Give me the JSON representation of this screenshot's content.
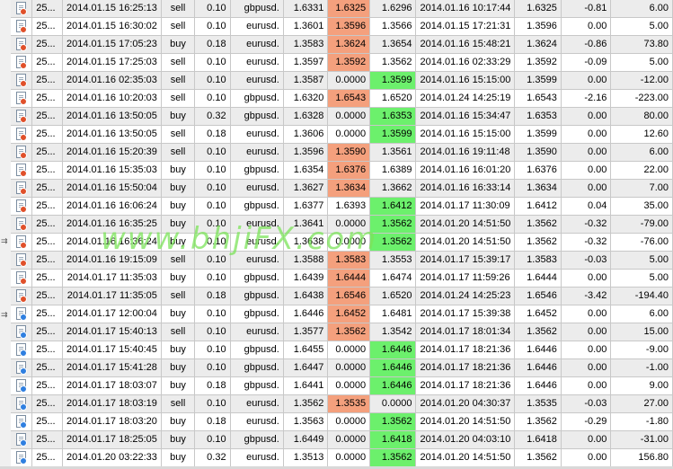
{
  "watermark": "www.bhjiFX.com",
  "colors": {
    "loss_price": "#f4a07d",
    "win_price": "#6cf06c",
    "sell_dot": "#e0502a",
    "buy_dot": "#2f7fe0"
  },
  "trades": [
    {
      "ticket": "25...",
      "open_time": "2014.01.15 16:25:13",
      "type": "sell",
      "size": "0.10",
      "symbol": "gbpusd.",
      "open_price": "1.6331",
      "sl": "1.6325",
      "tp": "1.6296",
      "close_time": "2014.01.16 10:17:44",
      "close_price": "1.6325",
      "swap": "-0.81",
      "profit": "6.00",
      "hl": "sl",
      "icon": "sell"
    },
    {
      "ticket": "25...",
      "open_time": "2014.01.15 16:30:02",
      "type": "sell",
      "size": "0.10",
      "symbol": "eurusd.",
      "open_price": "1.3601",
      "sl": "1.3596",
      "tp": "1.3566",
      "close_time": "2014.01.15 17:21:31",
      "close_price": "1.3596",
      "swap": "0.00",
      "profit": "5.00",
      "hl": "sl",
      "icon": "sell"
    },
    {
      "ticket": "25...",
      "open_time": "2014.01.15 17:05:23",
      "type": "buy",
      "size": "0.18",
      "symbol": "eurusd.",
      "open_price": "1.3583",
      "sl": "1.3624",
      "tp": "1.3654",
      "close_time": "2014.01.16 15:48:21",
      "close_price": "1.3624",
      "swap": "-0.86",
      "profit": "73.80",
      "hl": "sl",
      "icon": "sell"
    },
    {
      "ticket": "25...",
      "open_time": "2014.01.15 17:25:03",
      "type": "sell",
      "size": "0.10",
      "symbol": "eurusd.",
      "open_price": "1.3597",
      "sl": "1.3592",
      "tp": "1.3562",
      "close_time": "2014.01.16 02:33:29",
      "close_price": "1.3592",
      "swap": "-0.09",
      "profit": "5.00",
      "hl": "sl",
      "icon": "sell"
    },
    {
      "ticket": "25...",
      "open_time": "2014.01.16 02:35:03",
      "type": "sell",
      "size": "0.10",
      "symbol": "eurusd.",
      "open_price": "1.3587",
      "sl": "0.0000",
      "tp": "1.3599",
      "close_time": "2014.01.16 15:15:00",
      "close_price": "1.3599",
      "swap": "0.00",
      "profit": "-12.00",
      "hl": "tp",
      "icon": "sell"
    },
    {
      "ticket": "25...",
      "open_time": "2014.01.16 10:20:03",
      "type": "sell",
      "size": "0.10",
      "symbol": "gbpusd.",
      "open_price": "1.6320",
      "sl": "1.6543",
      "tp": "1.6520",
      "close_time": "2014.01.24 14:25:19",
      "close_price": "1.6543",
      "swap": "-2.16",
      "profit": "-223.00",
      "hl": "sl",
      "icon": "sell"
    },
    {
      "ticket": "25...",
      "open_time": "2014.01.16 13:50:05",
      "type": "buy",
      "size": "0.32",
      "symbol": "gbpusd.",
      "open_price": "1.6328",
      "sl": "0.0000",
      "tp": "1.6353",
      "close_time": "2014.01.16 15:34:47",
      "close_price": "1.6353",
      "swap": "0.00",
      "profit": "80.00",
      "hl": "tp",
      "icon": "sell"
    },
    {
      "ticket": "25...",
      "open_time": "2014.01.16 13:50:05",
      "type": "sell",
      "size": "0.18",
      "symbol": "eurusd.",
      "open_price": "1.3606",
      "sl": "0.0000",
      "tp": "1.3599",
      "close_time": "2014.01.16 15:15:00",
      "close_price": "1.3599",
      "swap": "0.00",
      "profit": "12.60",
      "hl": "tp",
      "icon": "sell"
    },
    {
      "ticket": "25...",
      "open_time": "2014.01.16 15:20:39",
      "type": "sell",
      "size": "0.10",
      "symbol": "eurusd.",
      "open_price": "1.3596",
      "sl": "1.3590",
      "tp": "1.3561",
      "close_time": "2014.01.16 19:11:48",
      "close_price": "1.3590",
      "swap": "0.00",
      "profit": "6.00",
      "hl": "sl",
      "icon": "sell"
    },
    {
      "ticket": "25...",
      "open_time": "2014.01.16 15:35:03",
      "type": "buy",
      "size": "0.10",
      "symbol": "gbpusd.",
      "open_price": "1.6354",
      "sl": "1.6376",
      "tp": "1.6389",
      "close_time": "2014.01.16 16:01:20",
      "close_price": "1.6376",
      "swap": "0.00",
      "profit": "22.00",
      "hl": "sl",
      "icon": "sell"
    },
    {
      "ticket": "25...",
      "open_time": "2014.01.16 15:50:04",
      "type": "buy",
      "size": "0.10",
      "symbol": "eurusd.",
      "open_price": "1.3627",
      "sl": "1.3634",
      "tp": "1.3662",
      "close_time": "2014.01.16 16:33:14",
      "close_price": "1.3634",
      "swap": "0.00",
      "profit": "7.00",
      "hl": "sl",
      "icon": "sell"
    },
    {
      "ticket": "25...",
      "open_time": "2014.01.16 16:06:24",
      "type": "buy",
      "size": "0.10",
      "symbol": "gbpusd.",
      "open_price": "1.6377",
      "sl": "1.6393",
      "tp": "1.6412",
      "close_time": "2014.01.17 11:30:09",
      "close_price": "1.6412",
      "swap": "0.04",
      "profit": "35.00",
      "hl": "tp",
      "icon": "sell"
    },
    {
      "ticket": "25...",
      "open_time": "2014.01.16 16:35:25",
      "type": "buy",
      "size": "0.10",
      "symbol": "eurusd.",
      "open_price": "1.3641",
      "sl": "0.0000",
      "tp": "1.3562",
      "close_time": "2014.01.20 14:51:50",
      "close_price": "1.3562",
      "swap": "-0.32",
      "profit": "-79.00",
      "hl": "tp",
      "icon": "sell"
    },
    {
      "ticket": "25...",
      "open_time": "2014.01.16 16:36:24",
      "type": "buy",
      "size": "0.10",
      "symbol": "eurusd.",
      "open_price": "1.3638",
      "sl": "0.0000",
      "tp": "1.3562",
      "close_time": "2014.01.20 14:51:50",
      "close_price": "1.3562",
      "swap": "-0.32",
      "profit": "-76.00",
      "hl": "tp",
      "icon": "sell"
    },
    {
      "ticket": "25...",
      "open_time": "2014.01.16 19:15:09",
      "type": "sell",
      "size": "0.10",
      "symbol": "eurusd.",
      "open_price": "1.3588",
      "sl": "1.3583",
      "tp": "1.3553",
      "close_time": "2014.01.17 15:39:17",
      "close_price": "1.3583",
      "swap": "-0.03",
      "profit": "5.00",
      "hl": "sl",
      "icon": "sell"
    },
    {
      "ticket": "25...",
      "open_time": "2014.01.17 11:35:03",
      "type": "buy",
      "size": "0.10",
      "symbol": "gbpusd.",
      "open_price": "1.6439",
      "sl": "1.6444",
      "tp": "1.6474",
      "close_time": "2014.01.17 11:59:26",
      "close_price": "1.6444",
      "swap": "0.00",
      "profit": "5.00",
      "hl": "sl",
      "icon": "sell"
    },
    {
      "ticket": "25...",
      "open_time": "2014.01.17 11:35:05",
      "type": "sell",
      "size": "0.18",
      "symbol": "gbpusd.",
      "open_price": "1.6438",
      "sl": "1.6546",
      "tp": "1.6520",
      "close_time": "2014.01.24 14:25:23",
      "close_price": "1.6546",
      "swap": "-3.42",
      "profit": "-194.40",
      "hl": "sl",
      "icon": "sell"
    },
    {
      "ticket": "25...",
      "open_time": "2014.01.17 12:00:04",
      "type": "buy",
      "size": "0.10",
      "symbol": "gbpusd.",
      "open_price": "1.6446",
      "sl": "1.6452",
      "tp": "1.6481",
      "close_time": "2014.01.17 15:39:38",
      "close_price": "1.6452",
      "swap": "0.00",
      "profit": "6.00",
      "hl": "sl",
      "icon": "buy"
    },
    {
      "ticket": "25...",
      "open_time": "2014.01.17 15:40:13",
      "type": "sell",
      "size": "0.10",
      "symbol": "eurusd.",
      "open_price": "1.3577",
      "sl": "1.3562",
      "tp": "1.3542",
      "close_time": "2014.01.17 18:01:34",
      "close_price": "1.3562",
      "swap": "0.00",
      "profit": "15.00",
      "hl": "sl",
      "icon": "buy"
    },
    {
      "ticket": "25...",
      "open_time": "2014.01.17 15:40:45",
      "type": "buy",
      "size": "0.10",
      "symbol": "gbpusd.",
      "open_price": "1.6455",
      "sl": "0.0000",
      "tp": "1.6446",
      "close_time": "2014.01.17 18:21:36",
      "close_price": "1.6446",
      "swap": "0.00",
      "profit": "-9.00",
      "hl": "tp",
      "icon": "buy"
    },
    {
      "ticket": "25...",
      "open_time": "2014.01.17 15:41:28",
      "type": "buy",
      "size": "0.10",
      "symbol": "gbpusd.",
      "open_price": "1.6447",
      "sl": "0.0000",
      "tp": "1.6446",
      "close_time": "2014.01.17 18:21:36",
      "close_price": "1.6446",
      "swap": "0.00",
      "profit": "-1.00",
      "hl": "tp",
      "icon": "buy"
    },
    {
      "ticket": "25...",
      "open_time": "2014.01.17 18:03:07",
      "type": "buy",
      "size": "0.18",
      "symbol": "gbpusd.",
      "open_price": "1.6441",
      "sl": "0.0000",
      "tp": "1.6446",
      "close_time": "2014.01.17 18:21:36",
      "close_price": "1.6446",
      "swap": "0.00",
      "profit": "9.00",
      "hl": "tp",
      "icon": "buy"
    },
    {
      "ticket": "25...",
      "open_time": "2014.01.17 18:03:19",
      "type": "sell",
      "size": "0.10",
      "symbol": "eurusd.",
      "open_price": "1.3562",
      "sl": "1.3535",
      "tp": "0.0000",
      "close_time": "2014.01.20 04:30:37",
      "close_price": "1.3535",
      "swap": "-0.03",
      "profit": "27.00",
      "hl": "sl",
      "icon": "buy"
    },
    {
      "ticket": "25...",
      "open_time": "2014.01.17 18:03:20",
      "type": "buy",
      "size": "0.18",
      "symbol": "eurusd.",
      "open_price": "1.3563",
      "sl": "0.0000",
      "tp": "1.3562",
      "close_time": "2014.01.20 14:51:50",
      "close_price": "1.3562",
      "swap": "-0.29",
      "profit": "-1.80",
      "hl": "tp",
      "icon": "buy"
    },
    {
      "ticket": "25...",
      "open_time": "2014.01.17 18:25:05",
      "type": "buy",
      "size": "0.10",
      "symbol": "gbpusd.",
      "open_price": "1.6449",
      "sl": "0.0000",
      "tp": "1.6418",
      "close_time": "2014.01.20 04:03:10",
      "close_price": "1.6418",
      "swap": "0.00",
      "profit": "-31.00",
      "hl": "tp",
      "icon": "buy"
    },
    {
      "ticket": "25...",
      "open_time": "2014.01.20 03:22:33",
      "type": "buy",
      "size": "0.32",
      "symbol": "eurusd.",
      "open_price": "1.3513",
      "sl": "0.0000",
      "tp": "1.3562",
      "close_time": "2014.01.20 14:51:50",
      "close_price": "1.3562",
      "swap": "0.00",
      "profit": "156.80",
      "hl": "tp",
      "icon": "buy"
    }
  ]
}
